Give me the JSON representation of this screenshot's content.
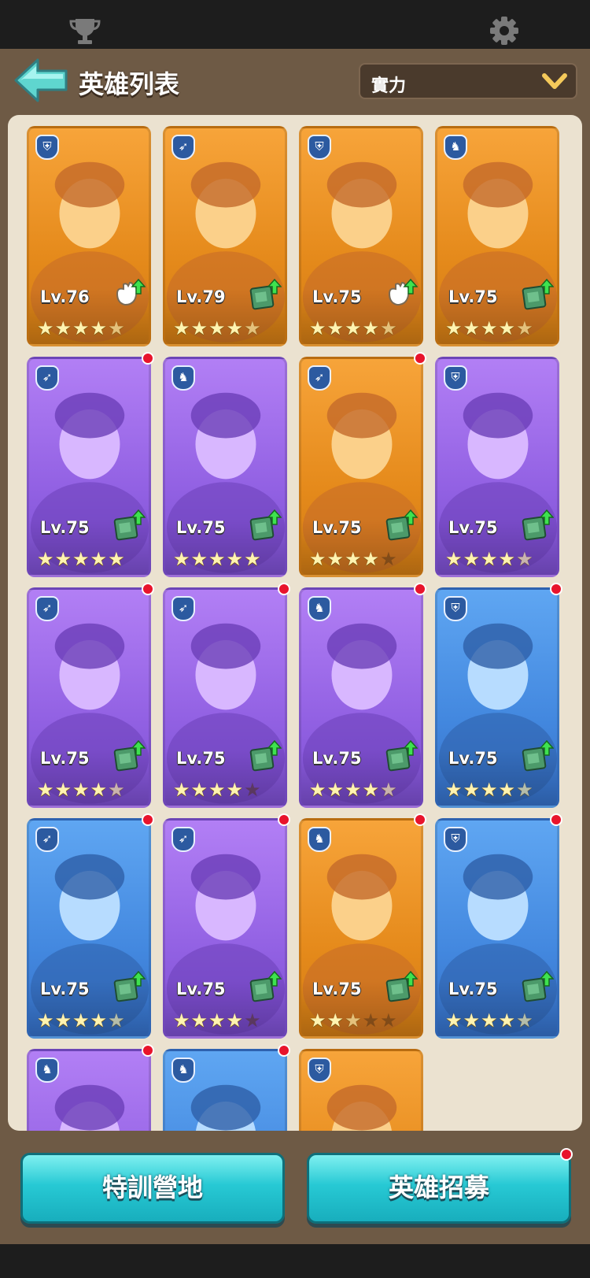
{
  "top": {
    "icons": [
      "trophy-icon",
      "gear-icon"
    ]
  },
  "header": {
    "title": "英雄列表",
    "sort_value": "實力"
  },
  "colors": {
    "gold": "#e58a1b",
    "purple": "#9261e3",
    "blue": "#4388df",
    "teal_button": "#27c9d4",
    "red_dot": "#e8142c"
  },
  "heroes": [
    {
      "level": "Lv.76",
      "frame": "gold",
      "role": "shield",
      "stars": 4.5,
      "upgrade": "glove",
      "dot": false
    },
    {
      "level": "Lv.79",
      "frame": "gold",
      "role": "bow",
      "stars": 4.5,
      "upgrade": "book",
      "dot": false
    },
    {
      "level": "Lv.75",
      "frame": "gold",
      "role": "shield",
      "stars": 4.5,
      "upgrade": "glove",
      "dot": false
    },
    {
      "level": "Lv.75",
      "frame": "gold",
      "role": "horse",
      "stars": 4.5,
      "upgrade": "book",
      "dot": false
    },
    {
      "level": "Lv.75",
      "frame": "purple",
      "role": "bow",
      "stars": 5,
      "upgrade": "book",
      "dot": true
    },
    {
      "level": "Lv.75",
      "frame": "purple",
      "role": "horse",
      "stars": 5,
      "upgrade": "book",
      "dot": false
    },
    {
      "level": "Lv.75",
      "frame": "gold",
      "role": "bow",
      "stars": 4,
      "upgrade": "book",
      "dot": true
    },
    {
      "level": "Lv.75",
      "frame": "purple",
      "role": "shield",
      "stars": 4.5,
      "upgrade": "book",
      "dot": false
    },
    {
      "level": "Lv.75",
      "frame": "purple",
      "role": "bow",
      "stars": 4.5,
      "upgrade": "book",
      "dot": true
    },
    {
      "level": "Lv.75",
      "frame": "purple",
      "role": "bow",
      "stars": 4,
      "upgrade": "book",
      "dot": true
    },
    {
      "level": "Lv.75",
      "frame": "purple",
      "role": "horse",
      "stars": 4.5,
      "upgrade": "book",
      "dot": true
    },
    {
      "level": "Lv.75",
      "frame": "blue",
      "role": "shield",
      "stars": 4.5,
      "upgrade": "book",
      "dot": true
    },
    {
      "level": "Lv.75",
      "frame": "blue",
      "role": "bow",
      "stars": 4.5,
      "upgrade": "book",
      "dot": true
    },
    {
      "level": "Lv.75",
      "frame": "purple",
      "role": "bow",
      "stars": 4,
      "upgrade": "book",
      "dot": true
    },
    {
      "level": "Lv.75",
      "frame": "gold",
      "role": "horse",
      "stars": 2.5,
      "upgrade": "book",
      "dot": true
    },
    {
      "level": "Lv.75",
      "frame": "blue",
      "role": "shield",
      "stars": 4.5,
      "upgrade": "book",
      "dot": true
    },
    {
      "level": "",
      "frame": "purple",
      "role": "horse",
      "stars": 0,
      "upgrade": "none",
      "dot": true
    },
    {
      "level": "",
      "frame": "blue",
      "role": "horse",
      "stars": 0,
      "upgrade": "none",
      "dot": true
    },
    {
      "level": "",
      "frame": "gold",
      "role": "shield",
      "stars": 0,
      "upgrade": "none",
      "dot": false
    }
  ],
  "buttons": {
    "training_camp": "特訓營地",
    "recruit": "英雄招募"
  }
}
